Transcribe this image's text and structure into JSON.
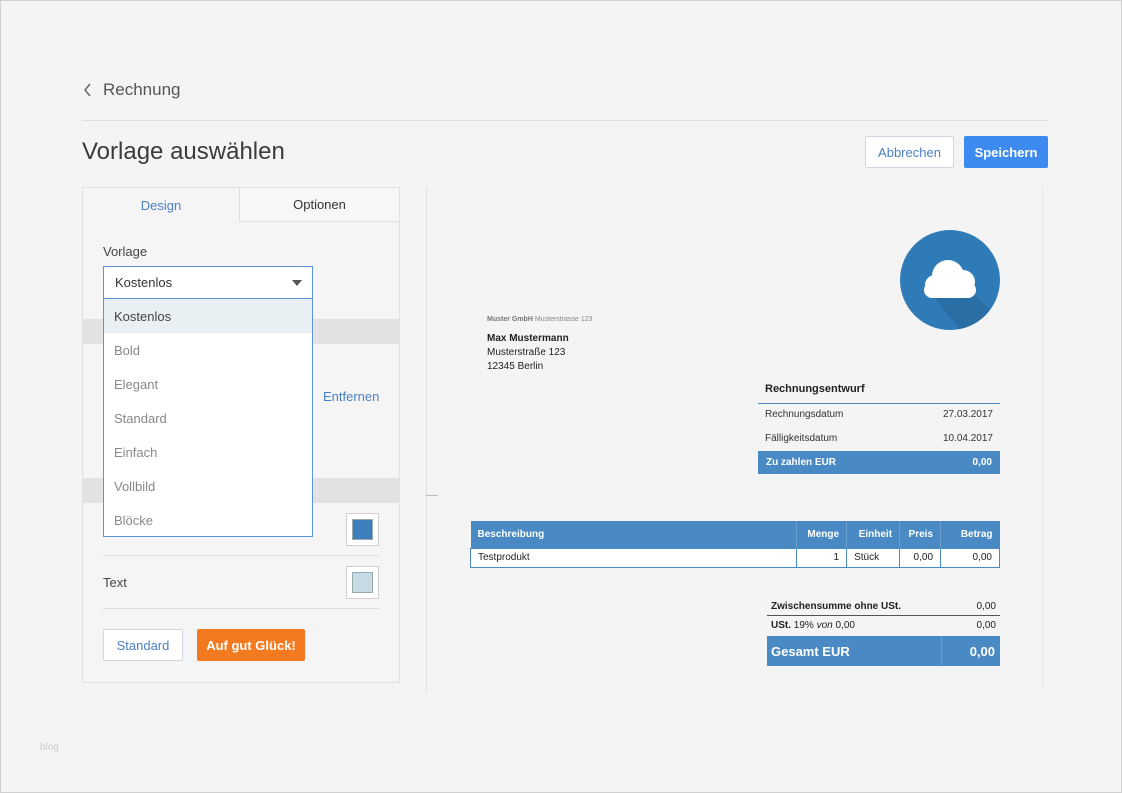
{
  "breadcrumb": {
    "label": "Rechnung"
  },
  "page": {
    "title": "Vorlage auswählen"
  },
  "actions": {
    "cancel": "Abbrechen",
    "save": "Speichern"
  },
  "tabs": [
    {
      "label": "Design"
    },
    {
      "label": "Optionen"
    }
  ],
  "template_field": {
    "label": "Vorlage",
    "selected": "Kostenlos",
    "options": [
      "Kostenlos",
      "Bold",
      "Elegant",
      "Standard",
      "Einfach",
      "Vollbild",
      "Blöcke"
    ]
  },
  "logo_section": {
    "remove_link": "Entfernen"
  },
  "colors": {
    "primary_swatch": "#3d7fbd",
    "text_label": "Text",
    "text_swatch": "#c7dbe6",
    "accent": "#3d8bf0",
    "lucky": "#f47a1f",
    "invoice_blue": "#4a8ac4"
  },
  "bottom_buttons": {
    "standard": "Standard",
    "lucky": "Auf gut Glück!"
  },
  "invoice": {
    "logo_icon": "cloud-icon",
    "sender_name": "Muster GmbH",
    "sender_address": "Musterstrasse 123",
    "recipient": {
      "name": "Max Mustermann",
      "street": "Musterstraße 123",
      "city": "12345 Berlin"
    },
    "meta": {
      "title": "Rechnungsentwurf",
      "date_label": "Rechnungsdatum",
      "date_value": "27.03.2017",
      "due_label": "Fälligkeitsdatum",
      "due_value": "10.04.2017",
      "total_label": "Zu zahlen EUR",
      "total_value": "0,00"
    },
    "table": {
      "headers": [
        "Beschreibung",
        "Menge",
        "Einheit",
        "Preis",
        "Betrag"
      ],
      "rows": [
        [
          "Testprodukt",
          "1",
          "Stück",
          "0,00",
          "0,00"
        ]
      ]
    },
    "summary": {
      "subtotal_label": "Zwischensumme ohne USt.",
      "subtotal_value": "0,00",
      "vat_label": "USt.",
      "vat_rate": "19%",
      "vat_of": "von",
      "vat_base": "0,00",
      "vat_value": "0,00",
      "grand_label": "Gesamt EUR",
      "grand_value": "0,00"
    }
  },
  "watermark": "blog"
}
